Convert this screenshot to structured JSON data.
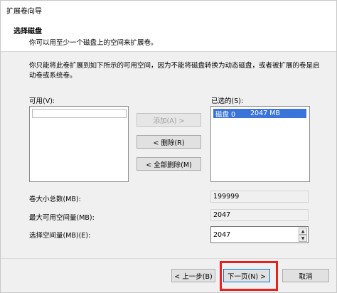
{
  "window": {
    "title": "扩展卷向导"
  },
  "header": {
    "title": "选择磁盘",
    "subtitle": "你可以用至少一个磁盘上的空间来扩展卷。"
  },
  "description": "你只能将此卷扩展到如下所示的可用空间，因为不能将磁盘转换为动态磁盘，或者被扩展的卷是启动卷或系统卷。",
  "available": {
    "label": "可用(V):",
    "items": []
  },
  "selected": {
    "label": "已选的(S):",
    "items": [
      {
        "disk": "磁盘 0",
        "size": "2047 MB"
      }
    ]
  },
  "buttons": {
    "add": "添加(A) >",
    "remove": "< 删除(R)",
    "remove_all": "< 全部删除(M)",
    "back": "< 上一步(B)",
    "next": "下一页(N) >",
    "cancel": "取消"
  },
  "fields": {
    "total_label": "卷大小总数(MB):",
    "total_value": "199999",
    "max_label": "最大可用空间量(MB):",
    "max_value": "2047",
    "select_label": "选择空间量(MB)(E):",
    "select_value": "2047"
  },
  "colors": {
    "selection": "#3b74d8",
    "highlight": "#e8211f"
  }
}
